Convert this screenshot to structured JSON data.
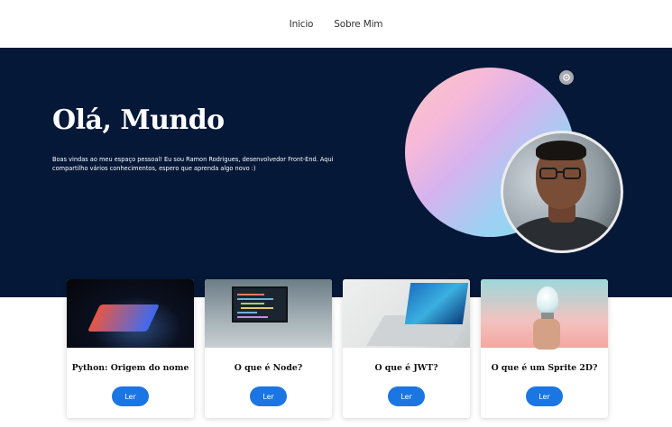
{
  "nav": {
    "items": [
      "Inicio",
      "Sobre Mim"
    ]
  },
  "hero": {
    "title": "Olá, Mundo",
    "text": "Boas vindas ao meu espaço pessoal! Eu sou Ramon Rodrigues, desenvolvedor Front-End. Aqui compartilho vários conhecimentos, espero que aprenda algo novo :)",
    "bg_color": "#061838"
  },
  "cards": [
    {
      "title": "Python: Origem do nome",
      "button": "Ler"
    },
    {
      "title": "O que é Node?",
      "button": "Ler"
    },
    {
      "title": "O que é JWT?",
      "button": "Ler"
    },
    {
      "title": "O que é um Sprite 2D?",
      "button": "Ler"
    }
  ],
  "colors": {
    "accent": "#1b76e3"
  }
}
